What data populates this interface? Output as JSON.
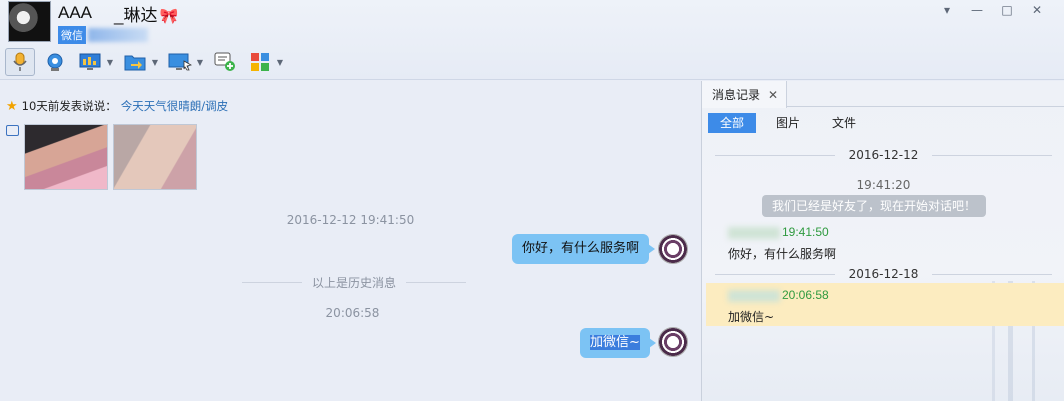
{
  "header": {
    "contact_name": "AAA",
    "contact_nick": "_琳达",
    "bow_emoji": "🎀",
    "tag": "微信"
  },
  "window_controls": [
    "▾",
    "—",
    "□",
    "✕"
  ],
  "toolbar": {
    "items": [
      {
        "icon": "microphone-icon",
        "has_dropdown": false,
        "active": true
      },
      {
        "icon": "webcam-icon",
        "has_dropdown": false
      },
      {
        "icon": "screen-chart-icon",
        "has_dropdown": true
      },
      {
        "icon": "folder-transfer-icon",
        "has_dropdown": true
      },
      {
        "icon": "remote-desktop-icon",
        "has_dropdown": true
      },
      {
        "icon": "add-message-icon",
        "has_dropdown": false
      },
      {
        "icon": "apps-grid-icon",
        "has_dropdown": true
      }
    ]
  },
  "chat": {
    "status_prefix": "10天前发表说说：",
    "status_text": "今天天气很晴朗/调皮",
    "time1": "2016-12-12 19:41:50",
    "msg1": "你好，有什么服务啊",
    "history_sep": "以上是历史消息",
    "time2": "20:06:58",
    "msg2": "加微信~"
  },
  "panel": {
    "tab_label": "消息记录",
    "tab_close": "✕",
    "filters": [
      "全部",
      "图片",
      "文件"
    ],
    "date1": "2016-12-12",
    "time1": "19:41:20",
    "system_msg": "我们已经是好友了，现在开始对话吧！",
    "rec1_time": "19:41:50",
    "rec1_text": "你好，有什么服务啊",
    "date2": "2016-12-18",
    "rec2_time": "20:06:58",
    "rec2_text": "加微信~"
  },
  "colors": {
    "accent": "#3d8be8",
    "bubble": "#7cc3f4",
    "highlight": "#fcecc0",
    "sender_green": "#2e9a3f"
  }
}
